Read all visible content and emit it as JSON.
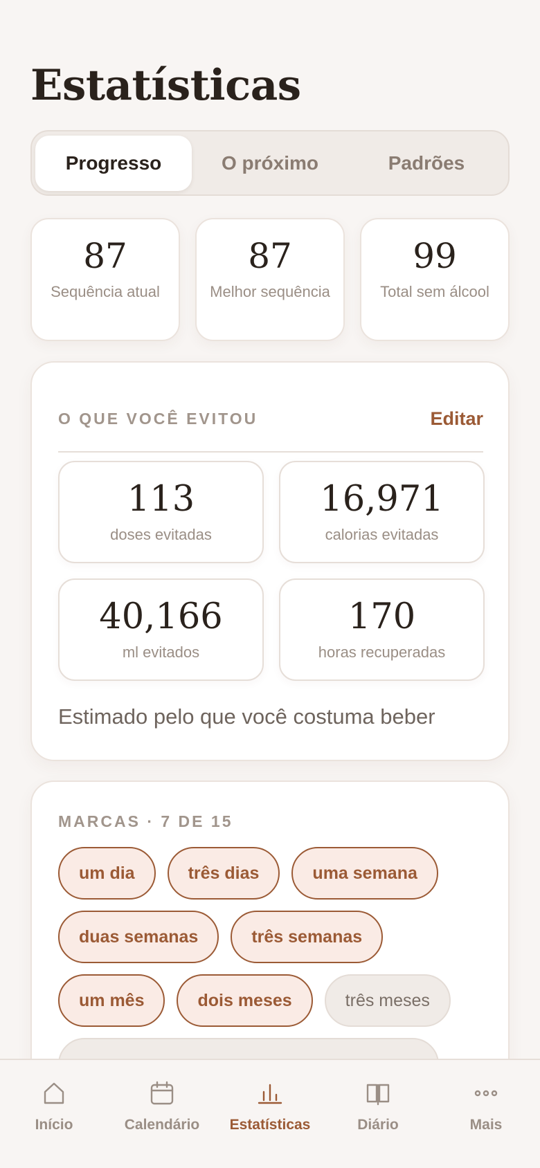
{
  "header": {
    "title": "Estatísticas"
  },
  "segments": [
    {
      "label": "Progresso",
      "active": true
    },
    {
      "label": "O próximo",
      "active": false
    },
    {
      "label": "Padrões",
      "active": false
    }
  ],
  "stats": [
    {
      "value": "87",
      "label": "Sequência atual"
    },
    {
      "value": "87",
      "label": "Melhor sequência"
    },
    {
      "value": "99",
      "label": "Total sem álcool"
    }
  ],
  "avoided": {
    "section_label": "O QUE VOCÊ EVITOU",
    "edit_label": "Editar",
    "items": [
      {
        "value": "113",
        "label": "doses evitadas"
      },
      {
        "value": "16,971",
        "label": "calorias evitadas"
      },
      {
        "value": "40,166",
        "label": "ml evitados"
      },
      {
        "value": "170",
        "label": "horas recuperadas"
      }
    ],
    "note": "Estimado pelo que você costuma beber"
  },
  "marks": {
    "section_label": "MARCAS · 7 DE 15",
    "chips": [
      {
        "label": "um dia",
        "achieved": true
      },
      {
        "label": "três dias",
        "achieved": true
      },
      {
        "label": "uma semana",
        "achieved": true
      },
      {
        "label": "duas semanas",
        "achieved": true
      },
      {
        "label": "três semanas",
        "achieved": true
      },
      {
        "label": "um mês",
        "achieved": true
      },
      {
        "label": "dois meses",
        "achieved": true
      },
      {
        "label": "três meses",
        "achieved": false
      }
    ]
  },
  "tabbar": [
    {
      "label": "Início",
      "icon": "home-icon",
      "active": false
    },
    {
      "label": "Calendário",
      "icon": "calendar-icon",
      "active": false
    },
    {
      "label": "Estatísticas",
      "icon": "bar-chart-icon",
      "active": true
    },
    {
      "label": "Diário",
      "icon": "book-icon",
      "active": false
    },
    {
      "label": "Mais",
      "icon": "more-icon",
      "active": false
    }
  ],
  "colors": {
    "accent": "#9b5a35",
    "background": "#f8f5f3",
    "chip_fill": "#faebe5"
  }
}
